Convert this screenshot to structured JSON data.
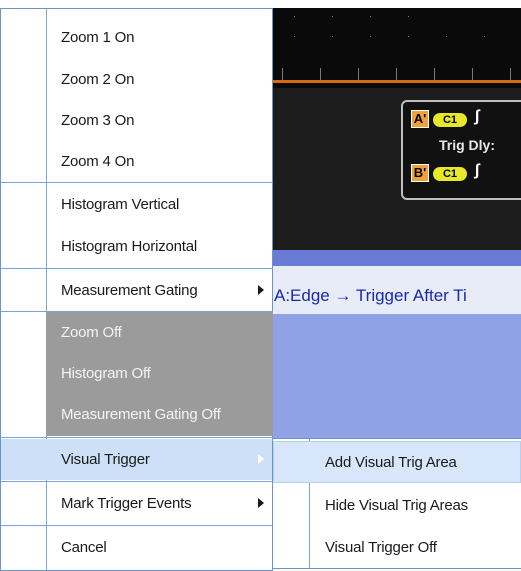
{
  "scope": {
    "trigger_box": {
      "a_letter": "A'",
      "b_letter": "B'",
      "a_channel": "C1",
      "b_channel": "C1",
      "edge_a": "∫",
      "edge_b": "∫",
      "trig_dly": "Trig Dly:"
    },
    "trigger_description": "A:Edge → Trigger After Ti"
  },
  "menu": {
    "items": [
      {
        "label": "Zoom 1 On",
        "has_submenu": false
      },
      {
        "label": "Zoom 2 On",
        "has_submenu": false
      },
      {
        "label": "Zoom 3 On",
        "has_submenu": false
      },
      {
        "label": "Zoom 4 On",
        "has_submenu": false
      },
      {
        "label": "Histogram Vertical",
        "has_submenu": false
      },
      {
        "label": "Histogram Horizontal",
        "has_submenu": false
      },
      {
        "label": "Measurement Gating",
        "has_submenu": true
      }
    ],
    "disabled_items": [
      {
        "label": "Zoom Off"
      },
      {
        "label": "Histogram Off"
      },
      {
        "label": "Measurement Gating Off"
      }
    ],
    "lower_items": [
      {
        "label": "Visual Trigger",
        "has_submenu": true,
        "selected": true
      },
      {
        "label": "Mark Trigger Events",
        "has_submenu": true
      },
      {
        "label": "Cancel",
        "has_submenu": false
      }
    ]
  },
  "submenu": {
    "items": [
      {
        "label": "Add Visual Trig Area",
        "hover": true
      },
      {
        "label": "Hide Visual Trig Areas"
      },
      {
        "label": "Visual Trigger Off"
      }
    ]
  },
  "colors": {
    "menu_border": "#6b95c9",
    "selected_bg": "#cde0f7",
    "disabled_bg": "#9b9b9b",
    "scope_trace": "#d86a12",
    "trigger_text": "#1a28b0"
  }
}
